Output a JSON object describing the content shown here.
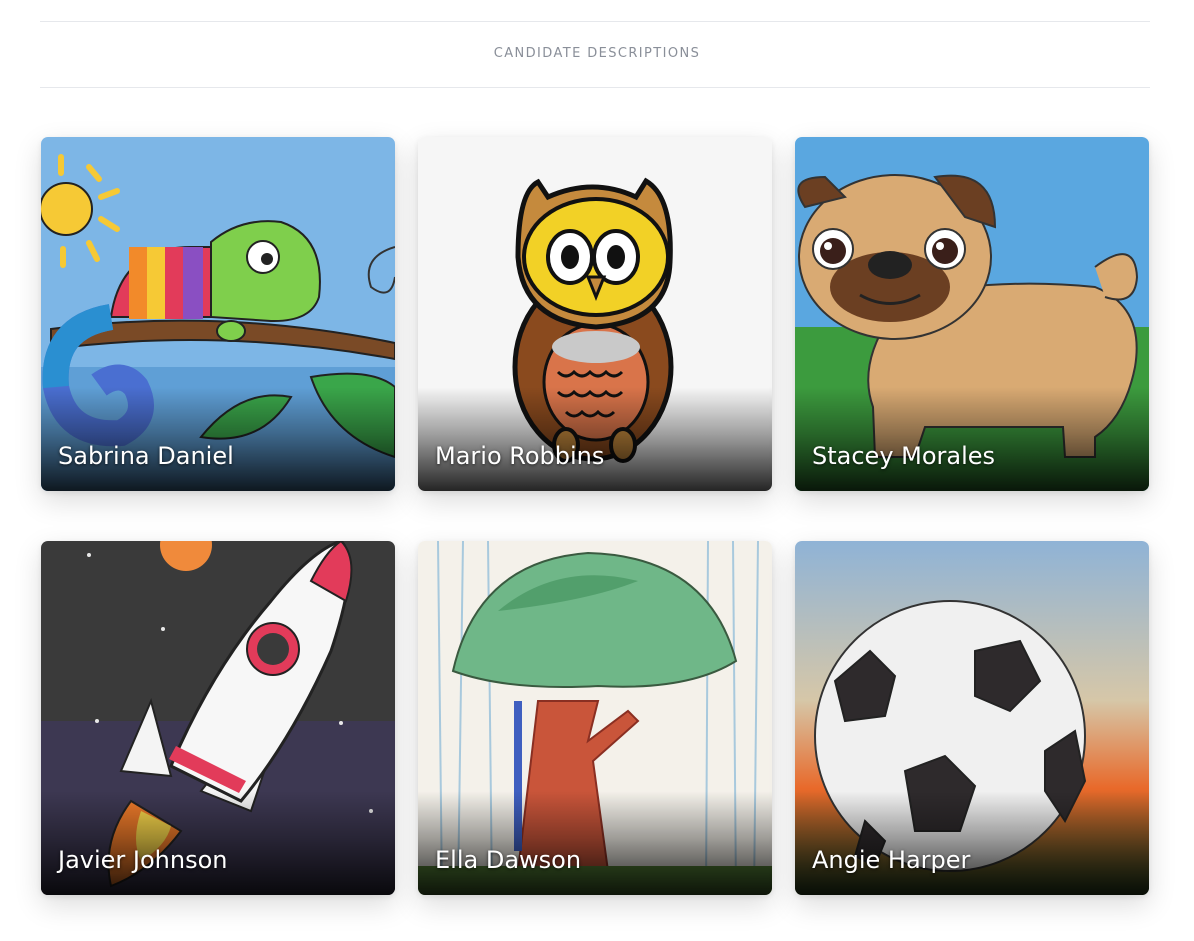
{
  "section": {
    "title": "CANDIDATE DESCRIPTIONS"
  },
  "candidates": [
    {
      "name": "Sabrina Daniel",
      "artwork": "chameleon-drawing"
    },
    {
      "name": "Mario Robbins",
      "artwork": "owl-drawing"
    },
    {
      "name": "Stacey Morales",
      "artwork": "pug-drawing"
    },
    {
      "name": "Javier Johnson",
      "artwork": "rocket-drawing"
    },
    {
      "name": "Ella Dawson",
      "artwork": "tree-drawing"
    },
    {
      "name": "Angie Harper",
      "artwork": "soccer-ball-drawing"
    }
  ]
}
